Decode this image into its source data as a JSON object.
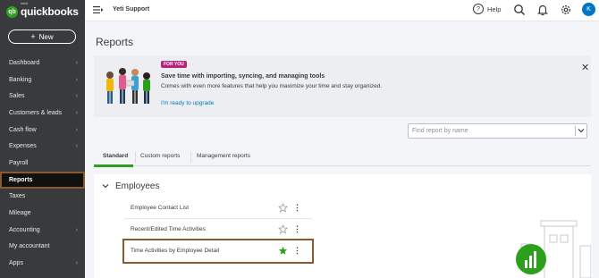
{
  "app": {
    "logo_intuit": "intuit",
    "logo_word": "quickbooks",
    "logo_mark": "qb",
    "new_button": "New",
    "new_plus": "+"
  },
  "sidebar": {
    "items": [
      {
        "label": "Dashboard",
        "chevron": true
      },
      {
        "label": "Banking",
        "chevron": true
      },
      {
        "label": "Sales",
        "chevron": true
      },
      {
        "label": "Customers & leads",
        "chevron": true
      },
      {
        "label": "Cash flow",
        "chevron": true
      },
      {
        "label": "Expenses",
        "chevron": true
      },
      {
        "label": "Payroll",
        "chevron": false
      },
      {
        "label": "Reports",
        "chevron": false,
        "active": true
      },
      {
        "label": "Taxes",
        "chevron": false
      },
      {
        "label": "Mileage",
        "chevron": false
      },
      {
        "label": "Accounting",
        "chevron": true
      },
      {
        "label": "My accountant",
        "chevron": false
      },
      {
        "label": "Apps",
        "chevron": true
      }
    ]
  },
  "topbar": {
    "company": "Yeti Support",
    "help_label": "Help",
    "help_icon_glyph": "?",
    "avatar_initial": "K",
    "icons": [
      "hamburger-icon",
      "search-icon",
      "bell-icon",
      "gear-icon"
    ]
  },
  "page": {
    "title": "Reports"
  },
  "promo": {
    "tag": "FOR YOU",
    "title": "Save time with importing, syncing, and managing tools",
    "subtitle": "Comes with even more features that help you maximize your time and stay organized.",
    "link": "I'm ready to upgrade",
    "close_glyph": "✕"
  },
  "search": {
    "placeholder": "Find report by name"
  },
  "tabs": [
    {
      "label": "Standard",
      "active": true
    },
    {
      "label": "Custom reports",
      "active": false
    },
    {
      "label": "Management reports",
      "active": false
    }
  ],
  "section": {
    "title": "Employees",
    "rows": [
      {
        "label": "Employee Contact List",
        "favorite": false
      },
      {
        "label": "Recent/Edited Time Activities",
        "favorite": false
      },
      {
        "label": "Time Activities by Employee Detail",
        "favorite": true
      }
    ]
  },
  "colors": {
    "brand_green": "#2ca01c",
    "sidebar_bg": "#393a3d",
    "link_blue": "#0077c5",
    "tag_magenta": "#b8237b",
    "highlight_outline": "#8a5a2b"
  }
}
